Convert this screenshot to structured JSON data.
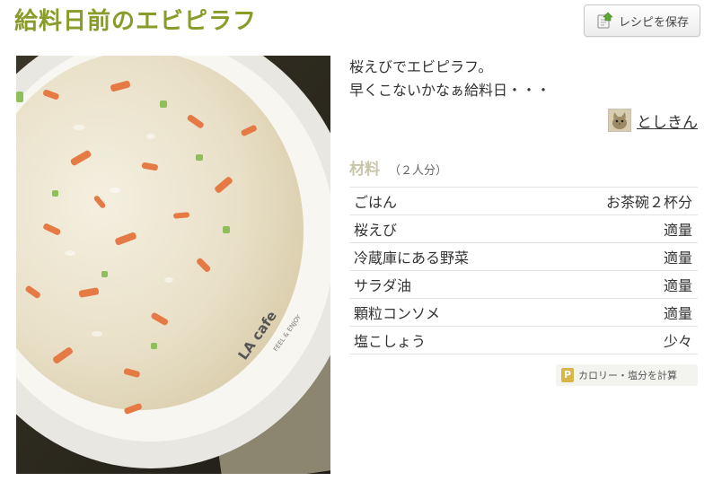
{
  "recipe": {
    "title": "給料日前のエビピラフ",
    "save_button": {
      "label": "レシピを保存",
      "icon": "save-recipe-icon"
    },
    "photo": {
      "icon": "recipe-photo",
      "plate_text_1": "LA cafe",
      "plate_text_2": "FEEL & ENJOY"
    },
    "description": [
      "桜えびでエビピラフ。",
      "早くこないかなぁ給料日・・・"
    ],
    "author": {
      "name": "としきん",
      "avatar_icon": "cat-avatar"
    },
    "ingredients": {
      "heading": "材料",
      "servings": "（２人分）",
      "items": [
        {
          "name": "ごはん",
          "amount": "お茶碗２杯分"
        },
        {
          "name": "桜えび",
          "amount": "適量"
        },
        {
          "name": "冷蔵庫にある野菜",
          "amount": "適量"
        },
        {
          "name": "サラダ油",
          "amount": "適量"
        },
        {
          "name": "顆粒コンソメ",
          "amount": "適量"
        },
        {
          "name": "塩こしょう",
          "amount": "少々"
        }
      ]
    },
    "calorie_button": {
      "label": "カロリー・塩分を計算",
      "icon_letter": "P"
    },
    "colors": {
      "title": "#8a9b2a",
      "ingredient_heading": "#c9c5aa",
      "premium_icon": "#d9b64a"
    }
  }
}
